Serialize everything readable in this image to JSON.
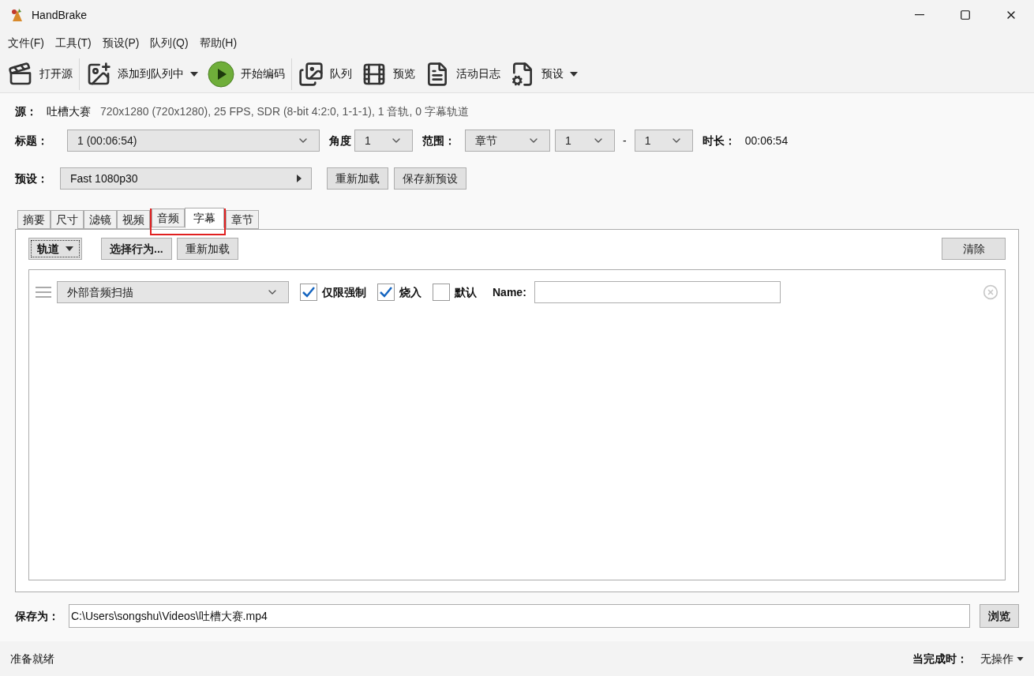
{
  "window": {
    "title": "HandBrake"
  },
  "menu": [
    "文件(F)",
    "工具(T)",
    "预设(P)",
    "队列(Q)",
    "帮助(H)"
  ],
  "toolbar": [
    {
      "kind": "open",
      "label": "打开源",
      "dropdown": false,
      "divider_after": true
    },
    {
      "kind": "add",
      "label": "添加到队列中",
      "dropdown": true,
      "divider_after": false
    },
    {
      "kind": "start",
      "label": "开始编码",
      "dropdown": false,
      "divider_after": true
    },
    {
      "kind": "queue",
      "label": "队列",
      "dropdown": false,
      "divider_after": false
    },
    {
      "kind": "preview",
      "label": "预览",
      "dropdown": false,
      "divider_after": false
    },
    {
      "kind": "log",
      "label": "活动日志",
      "dropdown": false,
      "divider_after": false
    },
    {
      "kind": "presets",
      "label": "预设",
      "dropdown": true,
      "divider_after": false
    }
  ],
  "source": {
    "label": "源：",
    "name": "吐槽大赛",
    "info": "720x1280 (720x1280), 25 FPS, SDR (8-bit 4:2:0, 1-1-1), 1 音轨, 0 字幕轨道"
  },
  "title_row": {
    "title_label": "标题：",
    "title_value": "1  (00:06:54)",
    "angle_label": "角度",
    "angle_value": "1",
    "range_label": "范围：",
    "range_value": "章节",
    "range_from": "1",
    "range_sep": "-",
    "range_to": "1",
    "duration_label": "时长：",
    "duration_value": "00:06:54"
  },
  "preset": {
    "label": "预设：",
    "value": "Fast 1080p30",
    "buttons": [
      "重新加载",
      "保存新预设"
    ]
  },
  "tabs": [
    {
      "label": "摘要",
      "selected": false,
      "highlighted": false
    },
    {
      "label": "尺寸",
      "selected": false,
      "highlighted": false
    },
    {
      "label": "滤镜",
      "selected": false,
      "highlighted": false
    },
    {
      "label": "视频",
      "selected": false,
      "highlighted": false
    },
    {
      "label": "音频",
      "selected": false,
      "highlighted": true
    },
    {
      "label": "字幕",
      "selected": true,
      "highlighted": true
    },
    {
      "label": "章节",
      "selected": false,
      "highlighted": false
    }
  ],
  "subtitles": {
    "tracks_button": "轨道",
    "choose_button": "选择行为...",
    "reload_button": "重新加载",
    "clear_button": "清除",
    "rows": [
      {
        "track": "外部音频扫描",
        "options": [
          {
            "label": "仅限强制",
            "checked": true
          },
          {
            "label": "烧入",
            "checked": true
          },
          {
            "label": "默认",
            "checked": false
          }
        ],
        "name_label": "Name:"
      }
    ]
  },
  "save_as": {
    "label": "保存为：",
    "value": "C:\\Users\\songshu\\Videos\\吐槽大赛.mp4",
    "browse": "浏览"
  },
  "status_bar": {
    "status": "准备就绪",
    "when_done_label": "当完成时：",
    "when_done_value": "无操作"
  }
}
